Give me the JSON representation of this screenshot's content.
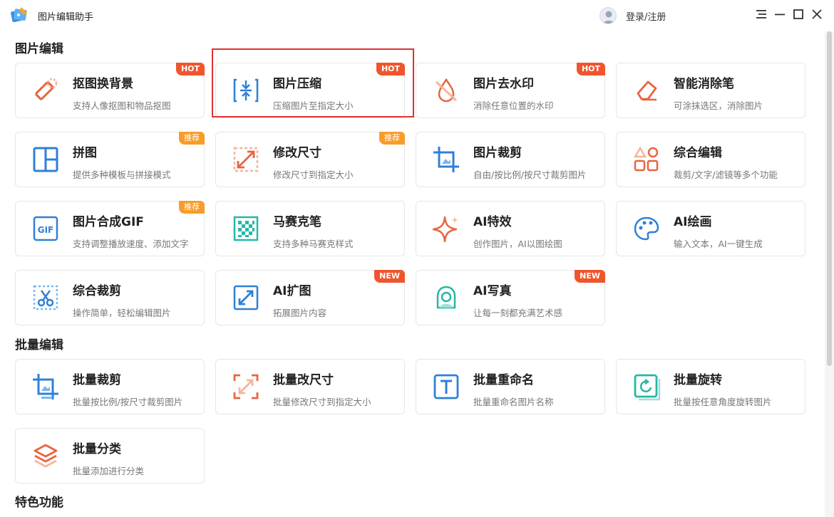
{
  "app": {
    "title": "图片编辑助手",
    "login": "登录/注册"
  },
  "colors": {
    "accent_red": "#e8653f",
    "accent_blue": "#2f80d8",
    "badge_hot": "#f0552c",
    "badge_recommend": "#f79c2b"
  },
  "sections": {
    "edit": {
      "title": "图片编辑"
    },
    "batch": {
      "title": "批量编辑"
    },
    "special": {
      "title": "特色功能"
    }
  },
  "cards": [
    {
      "title": "抠图换背景",
      "desc": "支持人像抠图和物品抠图",
      "badge": "HOT",
      "icon": "eraser-icon"
    },
    {
      "title": "图片压缩",
      "desc": "压缩图片至指定大小",
      "badge": "HOT",
      "icon": "compress-icon"
    },
    {
      "title": "图片去水印",
      "desc": "消除任意位置的水印",
      "badge": "HOT",
      "icon": "watermark-remove-icon"
    },
    {
      "title": "智能消除笔",
      "desc": "可涂抹选区，消除图片",
      "badge": "",
      "icon": "eraser-pen-icon"
    },
    {
      "title": "拼图",
      "desc": "提供多种模板与拼接模式",
      "badge": "推荐",
      "icon": "collage-icon"
    },
    {
      "title": "修改尺寸",
      "desc": "修改尺寸到指定大小",
      "badge": "推荐",
      "icon": "resize-icon"
    },
    {
      "title": "图片裁剪",
      "desc": "自由/按比例/按尺寸裁剪图片",
      "badge": "",
      "icon": "crop-icon"
    },
    {
      "title": "综合编辑",
      "desc": "裁剪/文字/滤镜等多个功能",
      "badge": "",
      "icon": "shapes-icon"
    },
    {
      "title": "图片合成GIF",
      "desc": "支持调整播放速度、添加文字",
      "badge": "推荐",
      "icon": "gif-icon"
    },
    {
      "title": "马赛克笔",
      "desc": "支持多种马赛克样式",
      "badge": "",
      "icon": "mosaic-icon"
    },
    {
      "title": "AI特效",
      "desc": "创作图片，AI以图绘图",
      "badge": "",
      "icon": "sparkle-icon"
    },
    {
      "title": "AI绘画",
      "desc": "输入文本，AI一键生成",
      "badge": "",
      "icon": "palette-icon"
    },
    {
      "title": "综合裁剪",
      "desc": "操作简单，轻松编辑图片",
      "badge": "",
      "icon": "scissors-icon"
    },
    {
      "title": "AI扩图",
      "desc": "拓展图片内容",
      "badge": "NEW",
      "icon": "expand-icon"
    },
    {
      "title": "AI写真",
      "desc": "让每一刻都充满艺术感",
      "badge": "NEW",
      "icon": "portrait-icon"
    },
    {
      "title": "批量裁剪",
      "desc": "批量按比例/按尺寸裁剪图片",
      "badge": "",
      "icon": "batch-crop-icon"
    },
    {
      "title": "批量改尺寸",
      "desc": "批量修改尺寸到指定大小",
      "badge": "",
      "icon": "batch-resize-icon"
    },
    {
      "title": "批量重命名",
      "desc": "批量重命名图片名称",
      "badge": "",
      "icon": "rename-icon"
    },
    {
      "title": "批量旋转",
      "desc": "批量按任意角度旋转图片",
      "badge": "",
      "icon": "rotate-icon"
    },
    {
      "title": "批量分类",
      "desc": "批量添加进行分类",
      "badge": "",
      "icon": "layers-icon"
    }
  ]
}
